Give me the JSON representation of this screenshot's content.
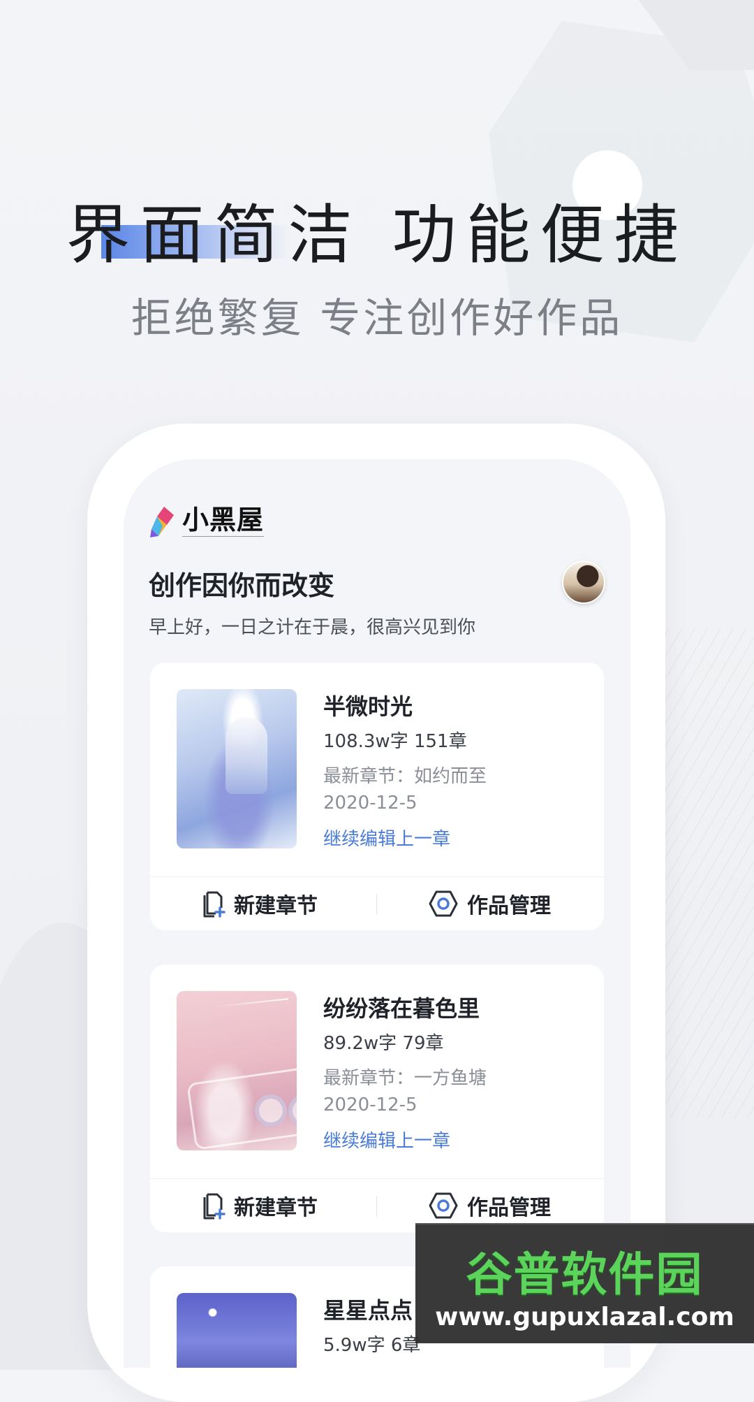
{
  "hero": {
    "headline": "界面简洁 功能便捷",
    "subtitle": "拒绝繁复 专注创作好作品",
    "accent_color": "#5a86e6"
  },
  "app": {
    "logo_text": "小黑屋",
    "greeting_title": "创作因你而改变",
    "greeting_subtitle": "早上好，一日之计在于晨，很高兴见到你"
  },
  "books": [
    {
      "title": "半微时光",
      "stats": "108.3w字 151章",
      "latest_chapter": "最新章节：如约而至",
      "date": "2020-12-5",
      "continue_label": "继续编辑上一章",
      "new_chapter_label": "新建章节",
      "manage_label": "作品管理"
    },
    {
      "title": "纷纷落在暮色里",
      "stats": "89.2w字 79章",
      "latest_chapter": "最新章节：一方鱼塘",
      "date": "2020-12-5",
      "continue_label": "继续编辑上一章",
      "new_chapter_label": "新建章节",
      "manage_label": "作品管理"
    },
    {
      "title": "星星点点",
      "stats": "5.9w字 6章"
    }
  ],
  "watermark": {
    "brand": "谷普软件园",
    "url": "www.gupuxlazal.com"
  },
  "colors": {
    "link": "#4a7bd6",
    "icon_blue": "#4a7bd6"
  }
}
